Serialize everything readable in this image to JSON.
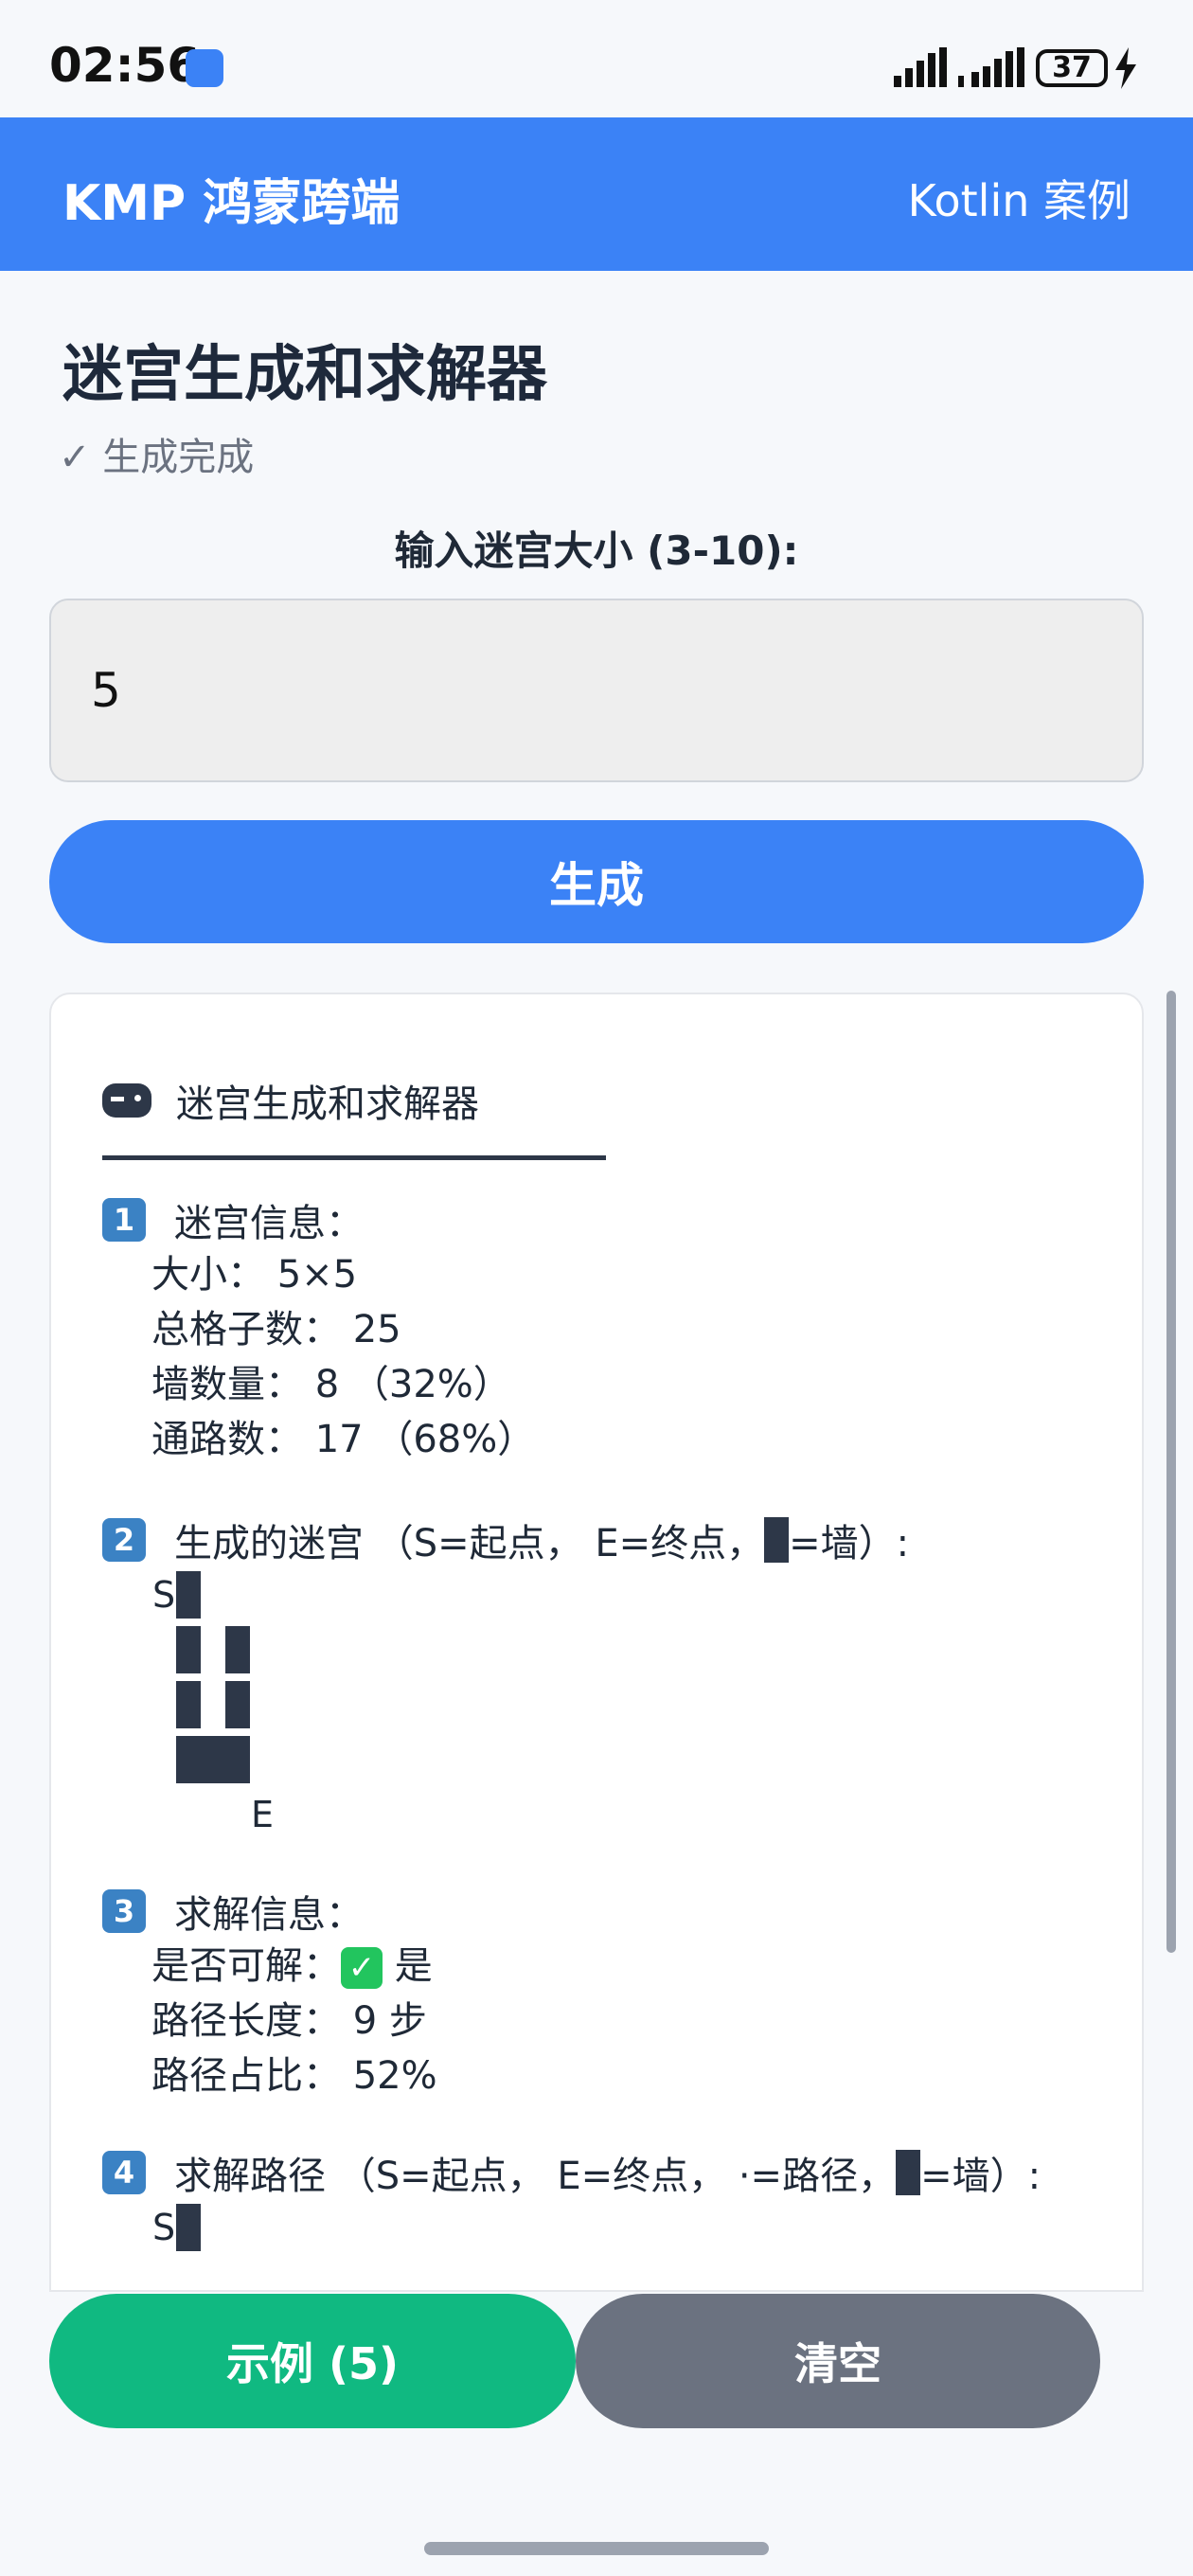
{
  "status_bar": {
    "time": "02:56",
    "battery": "37"
  },
  "app_bar": {
    "title": "KMP 鸿蒙跨端",
    "subtitle": "Kotlin 案例"
  },
  "page": {
    "title": "迷宫生成和求解器",
    "status": "✓ 生成完成"
  },
  "form": {
    "label": "输入迷宫大小 (3-10):",
    "value": "5",
    "generate_label": "生成"
  },
  "result": {
    "title": "迷宫生成和求解器",
    "sections": [
      {
        "num": "1",
        "heading": "迷宫信息：",
        "lines": [
          "大小： 5×5",
          "总格子数： 25",
          "墙数量： 8 （32%）",
          "通路数： 17 （68%）"
        ]
      },
      {
        "num": "2",
        "heading_pre": "生成的迷宫 （S=起点， E=终点， ",
        "heading_post": "=墙）:",
        "maze": [
          [
            "S",
            "#",
            " ",
            " ",
            " "
          ],
          [
            " ",
            "#",
            " ",
            "#",
            " "
          ],
          [
            " ",
            "#",
            " ",
            "#",
            " "
          ],
          [
            " ",
            "#",
            "#",
            "#",
            " "
          ],
          [
            " ",
            " ",
            " ",
            " ",
            "E"
          ]
        ]
      },
      {
        "num": "3",
        "heading": "求解信息：",
        "solvable_label": "是否可解：",
        "solvable_value": "是",
        "lines": [
          "路径长度： 9 步",
          "路径占比： 52%"
        ]
      },
      {
        "num": "4",
        "heading_pre": "求解路径 （S=起点， E=终点， ·=路径， ",
        "heading_post": "=墙）:",
        "first_row": [
          "S",
          "#"
        ]
      }
    ]
  },
  "buttons": {
    "example": "示例 (5)",
    "clear": "清空"
  },
  "colors": {
    "primary": "#3b82f6",
    "success": "#10b981",
    "neutral": "#6b7280",
    "wall": "#2d3748"
  }
}
